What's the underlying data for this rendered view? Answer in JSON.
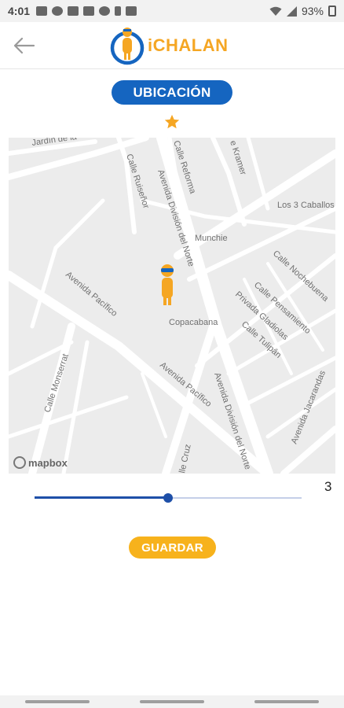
{
  "status_bar": {
    "time": "4:01",
    "battery": "93%",
    "icons": [
      "mail-icon",
      "eye-icon",
      "screen-icon",
      "chat-icon",
      "signal-app-icon",
      "person-icon",
      "bag-icon"
    ]
  },
  "header": {
    "back_icon": "arrow-left-icon",
    "logo_text": "iCHALAN",
    "logo_color": "#f5a623",
    "logo_ring_color": "#1565c0"
  },
  "title": "UBICACIÓN",
  "rating_star": "star-icon",
  "map": {
    "labels": {
      "jardin": "Jardín de la",
      "calle_reforma": "Calle Reforma",
      "kramer": "e Kramer",
      "calle_ruisenor": "Calle Ruiseñor",
      "avenida_division": "Avenida División del Norte",
      "los3caballos": "Los 3 Caballos",
      "munchie": "Munchie",
      "calle_nochebuena": "Calle Nochebuena",
      "calle_pensamiento": "Calle Pensamiento",
      "privada_gladiolas": "Privada Gladiolas",
      "calle_tulipan": "Calle Tulipán",
      "avenida_pacifico_1": "Avenida Pacífico",
      "copacabana": "Copacabana",
      "calle_monserrat": "Calle Monserrat",
      "avenida_pacifico_2": "Avenida Pacífico",
      "avenida_division_2": "Avenida División del Norte",
      "avenida_jacarandas": "Avenida Jacarandas",
      "calle_cruz": "lle Cruz"
    },
    "attribution": "mapbox"
  },
  "slider": {
    "value": 3,
    "value_text": "3",
    "min": 0,
    "max": 6
  },
  "save_label": "GUARDAR",
  "colors": {
    "primary": "#1565c0",
    "accent": "#f7b21c",
    "slider": "#1e4fa8"
  }
}
